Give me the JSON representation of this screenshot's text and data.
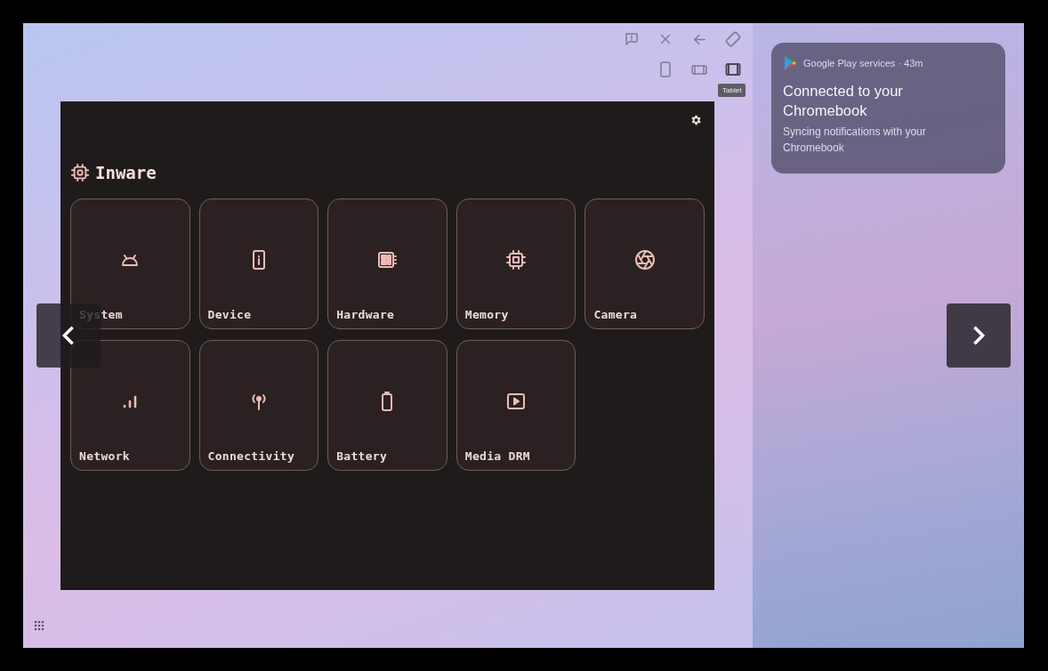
{
  "toolbar": {
    "actions": [
      {
        "kind": "feedback"
      },
      {
        "kind": "close"
      },
      {
        "kind": "back"
      },
      {
        "kind": "rotate"
      }
    ],
    "modes": [
      {
        "kind": "phone",
        "selected": false
      },
      {
        "kind": "landscape",
        "selected": false
      },
      {
        "kind": "tablet",
        "selected": true
      }
    ],
    "tooltip": "Tablet"
  },
  "app": {
    "title": "Inware",
    "tiles": [
      {
        "label": "System",
        "kind": "android"
      },
      {
        "label": "Device",
        "kind": "phone"
      },
      {
        "label": "Hardware",
        "kind": "board"
      },
      {
        "label": "Memory",
        "kind": "chip"
      },
      {
        "label": "Camera",
        "kind": "aperture"
      },
      {
        "label": "Network",
        "kind": "signal"
      },
      {
        "label": "Connectivity",
        "kind": "antenna"
      },
      {
        "label": "Battery",
        "kind": "battery"
      },
      {
        "label": "Media DRM",
        "kind": "play"
      }
    ]
  },
  "notification": {
    "source": "Google Play services · 43m",
    "title": "Connected to your Chromebook",
    "body": "Syncing notifications with your Chromebook"
  }
}
